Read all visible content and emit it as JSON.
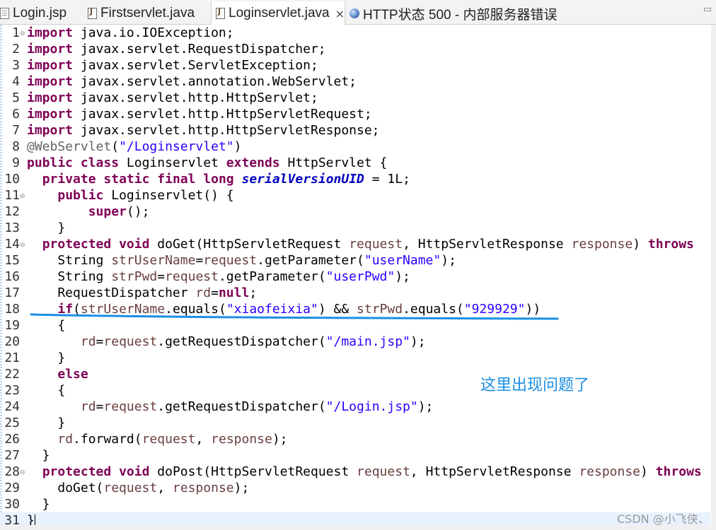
{
  "tabs": [
    {
      "label": "Login.jsp",
      "icon": "jsp-file-icon"
    },
    {
      "label": "Firstservlet.java",
      "icon": "java-file-icon"
    },
    {
      "label": "Loginservlet.java",
      "icon": "java-file-icon",
      "active": true,
      "close": "×"
    },
    {
      "label": "HTTP状态 500 - 内部服务器错误",
      "icon": "browser-globe-icon"
    }
  ],
  "tab_controls": "▭",
  "editor": {
    "current_line": 31,
    "lines": [
      {
        "n": "1",
        "fold": true,
        "tokens": [
          [
            "k",
            "import"
          ],
          [
            "",
            "java.io.IOException;"
          ]
        ]
      },
      {
        "n": "2",
        "tokens": [
          [
            "k",
            "import"
          ],
          [
            "",
            "javax.servlet.RequestDispatcher;"
          ]
        ]
      },
      {
        "n": "3",
        "tokens": [
          [
            "k",
            "import"
          ],
          [
            "",
            "javax.servlet.ServletException;"
          ]
        ]
      },
      {
        "n": "4",
        "tokens": [
          [
            "k",
            "import"
          ],
          [
            "",
            "javax.servlet.annotation.WebServlet;"
          ]
        ]
      },
      {
        "n": "5",
        "tokens": [
          [
            "k",
            "import"
          ],
          [
            "",
            "javax.servlet.http.HttpServlet;"
          ]
        ]
      },
      {
        "n": "6",
        "tokens": [
          [
            "k",
            "import"
          ],
          [
            "",
            "javax.servlet.http.HttpServletRequest;"
          ]
        ]
      },
      {
        "n": "7",
        "tokens": [
          [
            "k",
            "import"
          ],
          [
            "",
            "javax.servlet.http.HttpServletResponse;"
          ]
        ]
      },
      {
        "n": "8",
        "tokens": [
          [
            "a",
            "@WebServlet"
          ],
          [
            "",
            "("
          ],
          [
            "s",
            "\"/Loginservlet\""
          ],
          [
            "",
            ")"
          ]
        ]
      },
      {
        "n": "9",
        "tokens": [
          [
            "k",
            "public"
          ],
          [
            "",
            ""
          ],
          [
            "k",
            "class"
          ],
          [
            "",
            " Loginservlet "
          ],
          [
            "k",
            "extends"
          ],
          [
            "",
            " HttpServlet {"
          ]
        ]
      },
      {
        "n": "10",
        "tokens": [
          [
            "",
            "  "
          ],
          [
            "k",
            "private"
          ],
          [
            "",
            " "
          ],
          [
            "k",
            "static"
          ],
          [
            "",
            " "
          ],
          [
            "k",
            "final"
          ],
          [
            "",
            " "
          ],
          [
            "k",
            "long"
          ],
          [
            "",
            " "
          ],
          [
            "c",
            "serialVersionUID"
          ],
          [
            "",
            " = 1L;"
          ]
        ]
      },
      {
        "n": "11",
        "fold": true,
        "tokens": [
          [
            "",
            "    "
          ],
          [
            "k",
            "public"
          ],
          [
            "",
            " Loginservlet() {"
          ]
        ]
      },
      {
        "n": "12",
        "tokens": [
          [
            "",
            "        "
          ],
          [
            "k",
            "super"
          ],
          [
            "",
            "();"
          ]
        ]
      },
      {
        "n": "13",
        "tokens": [
          [
            "",
            "    }"
          ]
        ]
      },
      {
        "n": "14",
        "fold": true,
        "tokens": [
          [
            "",
            "  "
          ],
          [
            "k",
            "protected"
          ],
          [
            "",
            " "
          ],
          [
            "k",
            "void"
          ],
          [
            "",
            " doGet(HttpServletRequest "
          ],
          [
            "v",
            "request"
          ],
          [
            "",
            ", HttpServletResponse "
          ],
          [
            "v",
            "response"
          ],
          [
            "",
            ") "
          ],
          [
            "k",
            "throws"
          ]
        ]
      },
      {
        "n": "15",
        "tokens": [
          [
            "",
            "    String "
          ],
          [
            "v",
            "strUserName"
          ],
          [
            "",
            "="
          ],
          [
            "v",
            "request"
          ],
          [
            "",
            ".getParameter("
          ],
          [
            "s",
            "\"userName\""
          ],
          [
            "",
            ");"
          ]
        ]
      },
      {
        "n": "16",
        "tokens": [
          [
            "",
            "    String "
          ],
          [
            "v",
            "strPwd"
          ],
          [
            "",
            "="
          ],
          [
            "v",
            "request"
          ],
          [
            "",
            ".getParameter("
          ],
          [
            "s",
            "\"userPwd\""
          ],
          [
            "",
            ");"
          ]
        ]
      },
      {
        "n": "17",
        "tokens": [
          [
            "",
            "    RequestDispatcher "
          ],
          [
            "v",
            "rd"
          ],
          [
            "",
            "="
          ],
          [
            "k",
            "null"
          ],
          [
            "",
            ";"
          ]
        ]
      },
      {
        "n": "18",
        "tokens": [
          [
            "",
            "    "
          ],
          [
            "k",
            "if"
          ],
          [
            "",
            "("
          ],
          [
            "v",
            "strUserName"
          ],
          [
            "",
            ".equals("
          ],
          [
            "s",
            "\"xiaofeixia\""
          ],
          [
            "",
            ") && "
          ],
          [
            "v",
            "strPwd"
          ],
          [
            "",
            ".equals("
          ],
          [
            "s",
            "\"929929\""
          ],
          [
            "",
            "))"
          ]
        ]
      },
      {
        "n": "19",
        "tokens": [
          [
            "",
            "    {"
          ]
        ]
      },
      {
        "n": "20",
        "tokens": [
          [
            "",
            "       "
          ],
          [
            "v",
            "rd"
          ],
          [
            "",
            "="
          ],
          [
            "v",
            "request"
          ],
          [
            "",
            ".getRequestDispatcher("
          ],
          [
            "s",
            "\"/main.jsp\""
          ],
          [
            "",
            ");"
          ]
        ]
      },
      {
        "n": "21",
        "tokens": [
          [
            "",
            "    }"
          ]
        ]
      },
      {
        "n": "22",
        "tokens": [
          [
            "",
            "    "
          ],
          [
            "k",
            "else"
          ]
        ]
      },
      {
        "n": "23",
        "tokens": [
          [
            "",
            "    {"
          ]
        ]
      },
      {
        "n": "24",
        "tokens": [
          [
            "",
            "       "
          ],
          [
            "v",
            "rd"
          ],
          [
            "",
            "="
          ],
          [
            "v",
            "request"
          ],
          [
            "",
            ".getRequestDispatcher("
          ],
          [
            "s",
            "\"/Login.jsp\""
          ],
          [
            "",
            ");"
          ]
        ]
      },
      {
        "n": "25",
        "tokens": [
          [
            "",
            "    }"
          ]
        ]
      },
      {
        "n": "26",
        "tokens": [
          [
            "",
            "    "
          ],
          [
            "v",
            "rd"
          ],
          [
            "",
            ".forward("
          ],
          [
            "v",
            "request"
          ],
          [
            "",
            ", "
          ],
          [
            "v",
            "response"
          ],
          [
            "",
            ");"
          ]
        ]
      },
      {
        "n": "27",
        "tokens": [
          [
            "",
            "  }"
          ]
        ]
      },
      {
        "n": "28",
        "fold": true,
        "tokens": [
          [
            "",
            "  "
          ],
          [
            "k",
            "protected"
          ],
          [
            "",
            " "
          ],
          [
            "k",
            "void"
          ],
          [
            "",
            " doPost(HttpServletRequest "
          ],
          [
            "v",
            "request"
          ],
          [
            "",
            ", HttpServletResponse "
          ],
          [
            "v",
            "response"
          ],
          [
            "",
            ") "
          ],
          [
            "k",
            "throws"
          ]
        ]
      },
      {
        "n": "29",
        "tokens": [
          [
            "",
            "    doGet("
          ],
          [
            "v",
            "request"
          ],
          [
            "",
            ", "
          ],
          [
            "v",
            "response"
          ],
          [
            "",
            ");"
          ]
        ]
      },
      {
        "n": "30",
        "tokens": [
          [
            "",
            "  }"
          ]
        ]
      },
      {
        "n": "31",
        "tokens": [
          [
            "",
            "}"
          ]
        ]
      }
    ]
  },
  "annotation": {
    "text": "这里出现问题了",
    "color": "#1a8fe3",
    "underlined_line": "18"
  },
  "watermark": "CSDN @小飞侠、"
}
